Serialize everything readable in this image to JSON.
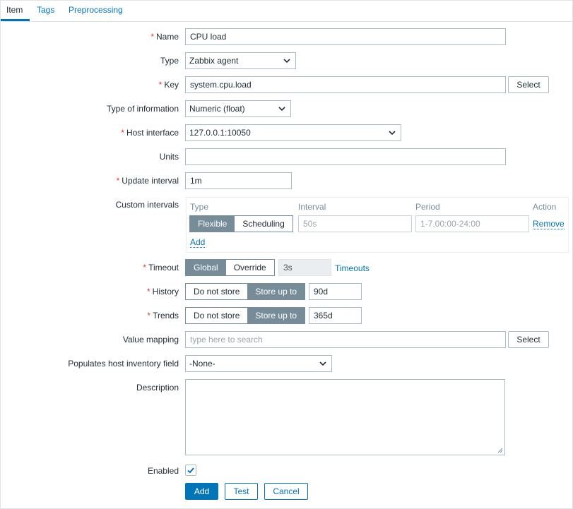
{
  "tabs": [
    {
      "label": "Item",
      "active": true
    },
    {
      "label": "Tags",
      "active": false
    },
    {
      "label": "Preprocessing",
      "active": false
    }
  ],
  "form": {
    "required_mark": "*",
    "name": {
      "label": "Name",
      "value": "CPU load",
      "required": true
    },
    "type": {
      "label": "Type",
      "value": "Zabbix agent"
    },
    "key": {
      "label": "Key",
      "value": "system.cpu.load",
      "required": true,
      "select_label": "Select"
    },
    "type_of_information": {
      "label": "Type of information",
      "value": "Numeric (float)"
    },
    "host_interface": {
      "label": "Host interface",
      "value": "127.0.0.1:10050",
      "required": true
    },
    "units": {
      "label": "Units",
      "value": ""
    },
    "update_interval": {
      "label": "Update interval",
      "value": "1m",
      "required": true
    },
    "custom_intervals": {
      "label": "Custom intervals",
      "columns": [
        "Type",
        "Interval",
        "Period",
        "Action"
      ],
      "row": {
        "type_options": [
          "Flexible",
          "Scheduling"
        ],
        "type_selected": "Flexible",
        "interval_placeholder": "50s",
        "period_placeholder": "1-7,00:00-24:00",
        "remove_label": "Remove"
      },
      "add_label": "Add"
    },
    "timeout": {
      "label": "Timeout",
      "required": true,
      "options": [
        "Global",
        "Override"
      ],
      "selected": "Global",
      "value": "3s",
      "link_label": "Timeouts"
    },
    "history": {
      "label": "History",
      "required": true,
      "options": [
        "Do not store",
        "Store up to"
      ],
      "selected": "Store up to",
      "value": "90d"
    },
    "trends": {
      "label": "Trends",
      "required": true,
      "options": [
        "Do not store",
        "Store up to"
      ],
      "selected": "Store up to",
      "value": "365d"
    },
    "value_mapping": {
      "label": "Value mapping",
      "placeholder": "type here to search",
      "select_label": "Select"
    },
    "inventory_field": {
      "label": "Populates host inventory field",
      "value": "-None-"
    },
    "description": {
      "label": "Description",
      "value": ""
    },
    "enabled": {
      "label": "Enabled",
      "checked": true
    }
  },
  "actions": {
    "add": "Add",
    "test": "Test",
    "cancel": "Cancel"
  },
  "colors": {
    "accent": "#0275b8",
    "required": "#e33734",
    "segment_active": "#768d99"
  }
}
